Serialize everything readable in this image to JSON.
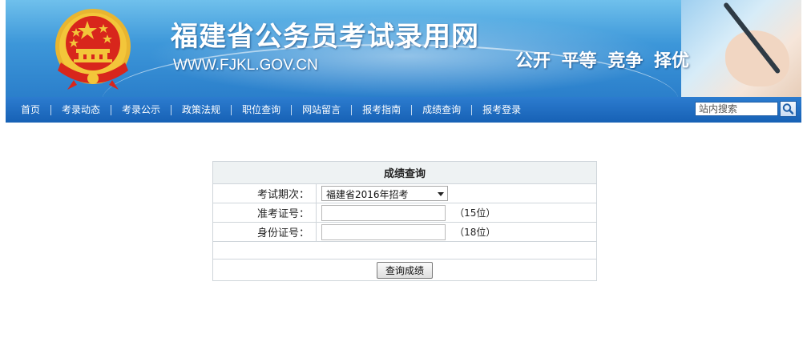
{
  "header": {
    "site_title": "福建省公务员考试录用网",
    "site_url": "WWW.FJKL.GOV.CN",
    "slogan": "公开 平等 竞争 择优"
  },
  "nav": {
    "items": [
      {
        "label": "首页"
      },
      {
        "label": "考录动态"
      },
      {
        "label": "考录公示"
      },
      {
        "label": "政策法规"
      },
      {
        "label": "职位查询"
      },
      {
        "label": "网站留言"
      },
      {
        "label": "报考指南"
      },
      {
        "label": "成绩查询"
      },
      {
        "label": "报考登录"
      }
    ],
    "search": {
      "placeholder": "站内搜索",
      "button_icon": "search-icon"
    }
  },
  "query_form": {
    "title": "成绩查询",
    "exam_period": {
      "label": "考试期次：",
      "selected": "福建省2016年招考"
    },
    "admission_no": {
      "label": "准考证号：",
      "value": "",
      "hint": "（15位）"
    },
    "id_no": {
      "label": "身份证号：",
      "value": "",
      "hint": "（18位）"
    },
    "submit_label": "查询成绩"
  },
  "colors": {
    "banner_top": "#6fc0ec",
    "banner_bottom": "#2b7fcb",
    "nav_bg": "#1761b5",
    "form_header_bg": "#eef2f3",
    "emblem_red": "#d8261c",
    "emblem_gold": "#f3c63a"
  }
}
